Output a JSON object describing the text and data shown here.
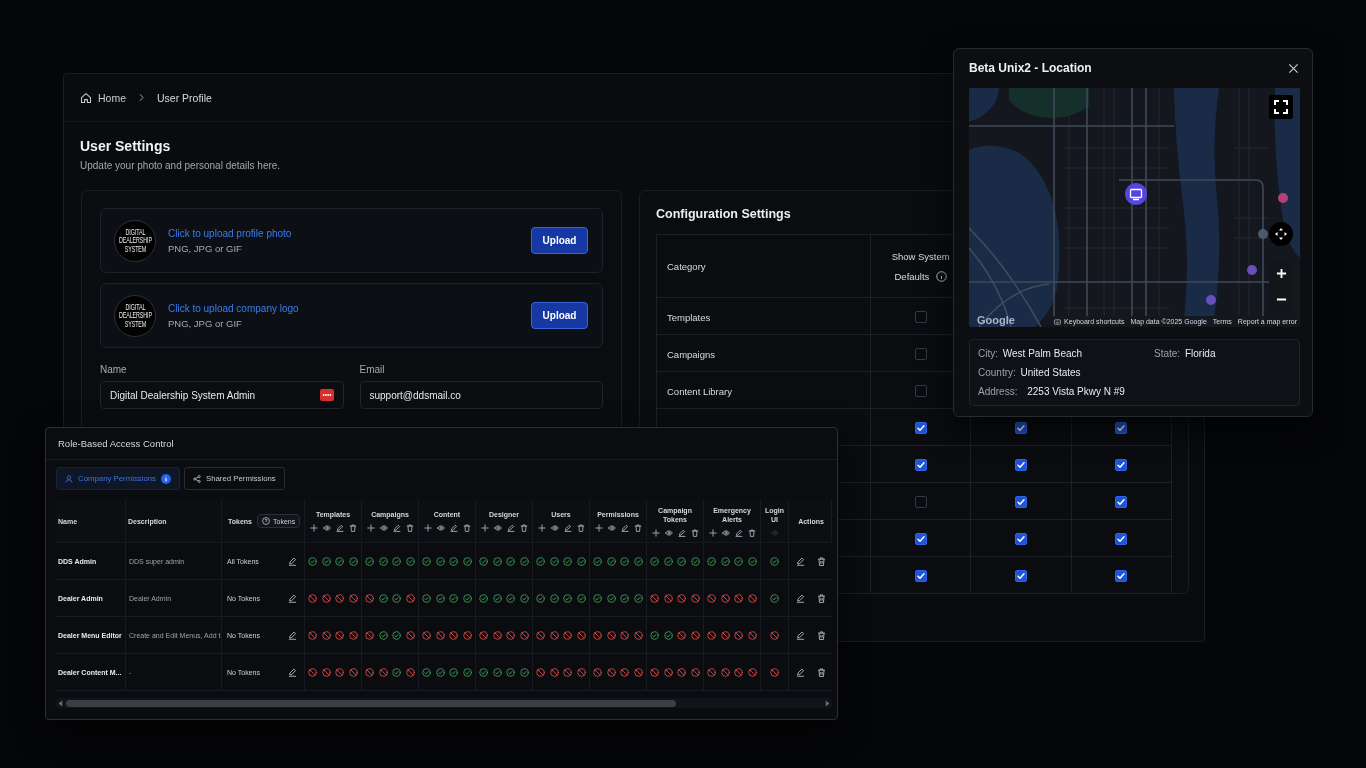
{
  "breadcrumb": [
    {
      "label": "Home",
      "kind": "home"
    },
    {
      "label": "User Profile",
      "kind": "page"
    }
  ],
  "settings": {
    "title": "User Settings",
    "subtitle": "Update your photo and personal details here.",
    "uploads": [
      {
        "logo_text": "DIGITAL DEALERSHIP SYSTEM",
        "link": "Click to upload profile photo",
        "hint": "PNG, JPG or GIF",
        "button": "Upload"
      },
      {
        "logo_text": "DIGITAL DEALERSHIP SYSTEM",
        "link": "Click to upload company logo",
        "hint": "PNG, JPG or GIF",
        "button": "Upload"
      }
    ],
    "fields": [
      {
        "label": "Name",
        "value": "Digital Dealership System Admin",
        "kind": "autofill"
      },
      {
        "label": "Email",
        "value": "support@ddsmail.co",
        "kind": "plain"
      }
    ]
  },
  "configuration": {
    "title": "Configuration Settings",
    "columns": [
      {
        "label": "Category",
        "info": false
      },
      {
        "label": "Show System Defaults",
        "info": true
      }
    ],
    "rows": [
      {
        "category": "Templates",
        "cells": [
          {
            "checked": false
          }
        ]
      },
      {
        "category": "Campaigns",
        "cells": [
          {
            "checked": false
          }
        ]
      },
      {
        "category": "Content Library",
        "cells": [
          {
            "checked": false
          }
        ]
      },
      {
        "cells": [
          {
            "checked": true
          },
          {
            "checked": true
          },
          {
            "checked": true
          }
        ]
      },
      {
        "cells": [
          {
            "checked": true
          },
          {
            "checked": true
          },
          {
            "checked": true
          }
        ]
      },
      {
        "cells": [
          {
            "checked": false
          },
          {
            "checked": true
          },
          {
            "checked": true
          }
        ]
      },
      {
        "cells": [
          {
            "checked": true
          },
          {
            "checked": true
          },
          {
            "checked": true
          }
        ]
      },
      {
        "cells": [
          {
            "checked": true
          },
          {
            "checked": true
          },
          {
            "checked": true
          }
        ]
      }
    ]
  },
  "location": {
    "title": "Beta Unix2 - Location",
    "map": {
      "logo": "Google",
      "attribution": [
        {
          "label": "Keyboard shortcuts",
          "kind": "shortcuts"
        },
        {
          "label": "Map data ©2025 Google",
          "kind": "text"
        },
        {
          "label": "Terms",
          "kind": "link"
        },
        {
          "label": "Report a map error",
          "kind": "link"
        }
      ]
    },
    "details": [
      {
        "label": "City:",
        "value": "West Palm Beach"
      },
      {
        "label": "State:",
        "value": "Florida"
      },
      {
        "label": "Country:",
        "value": "United States"
      },
      {
        "label": "Address:",
        "value": "2253 Vista Pkwy N #9"
      }
    ]
  },
  "access_control": {
    "title": "Role-Based Access Control",
    "tabs": [
      {
        "label": "Company Permissions",
        "kind": "company",
        "selected": true,
        "info": true
      },
      {
        "label": "Shared Permissions",
        "kind": "shared",
        "selected": false,
        "info": false
      }
    ],
    "columns": {
      "name": "Name",
      "description": "Description",
      "tokens": "Tokens",
      "tokens_button": "Tokens",
      "actions": "Actions"
    },
    "groups": [
      {
        "label": "Templates",
        "kind": "crud"
      },
      {
        "label": "Campaigns",
        "kind": "crud"
      },
      {
        "label": "Content",
        "kind": "crud"
      },
      {
        "label": "Designer",
        "kind": "crud"
      },
      {
        "label": "Users",
        "kind": "crud"
      },
      {
        "label": "Permissions",
        "kind": "crud"
      },
      {
        "label": "Campaign Tokens",
        "kind": "crud"
      },
      {
        "label": "Emergency Alerts",
        "kind": "crud"
      },
      {
        "label": "Login UI",
        "kind": "single"
      }
    ],
    "rows": [
      {
        "name": "DDS Admin",
        "description": "DDS super admin",
        "tokens": "All Tokens",
        "permissions": [
          [
            {
              "allowed": true
            },
            {
              "allowed": true
            },
            {
              "allowed": true
            },
            {
              "allowed": true
            }
          ],
          [
            {
              "allowed": true
            },
            {
              "allowed": true
            },
            {
              "allowed": true
            },
            {
              "allowed": true
            }
          ],
          [
            {
              "allowed": true
            },
            {
              "allowed": true
            },
            {
              "allowed": true
            },
            {
              "allowed": true
            }
          ],
          [
            {
              "allowed": true
            },
            {
              "allowed": true
            },
            {
              "allowed": true
            },
            {
              "allowed": true
            }
          ],
          [
            {
              "allowed": true
            },
            {
              "allowed": true
            },
            {
              "allowed": true
            },
            {
              "allowed": true
            }
          ],
          [
            {
              "allowed": true
            },
            {
              "allowed": true
            },
            {
              "allowed": true
            },
            {
              "allowed": true
            }
          ],
          [
            {
              "allowed": true
            },
            {
              "allowed": true
            },
            {
              "allowed": true
            },
            {
              "allowed": true
            }
          ],
          [
            {
              "allowed": true
            },
            {
              "allowed": true
            },
            {
              "allowed": true
            },
            {
              "allowed": true
            }
          ],
          [
            {
              "allowed": true
            }
          ]
        ]
      },
      {
        "name": "Dealer Admin",
        "description": "Dealer Admin",
        "tokens": "No Tokens",
        "permissions": [
          [
            {
              "allowed": false
            },
            {
              "allowed": false
            },
            {
              "allowed": false
            },
            {
              "allowed": false
            }
          ],
          [
            {
              "allowed": false
            },
            {
              "allowed": true
            },
            {
              "allowed": true
            },
            {
              "allowed": false
            }
          ],
          [
            {
              "allowed": true
            },
            {
              "allowed": true
            },
            {
              "allowed": true
            },
            {
              "allowed": true
            }
          ],
          [
            {
              "allowed": true
            },
            {
              "allowed": true
            },
            {
              "allowed": true
            },
            {
              "allowed": true
            }
          ],
          [
            {
              "allowed": true
            },
            {
              "allowed": true
            },
            {
              "allowed": true
            },
            {
              "allowed": true
            }
          ],
          [
            {
              "allowed": true
            },
            {
              "allowed": true
            },
            {
              "allowed": true
            },
            {
              "allowed": true
            }
          ],
          [
            {
              "allowed": false
            },
            {
              "allowed": false
            },
            {
              "allowed": false
            },
            {
              "allowed": false
            }
          ],
          [
            {
              "allowed": false
            },
            {
              "allowed": false
            },
            {
              "allowed": false
            },
            {
              "allowed": false
            }
          ],
          [
            {
              "allowed": true
            }
          ]
        ]
      },
      {
        "name": "Dealer Menu Editor",
        "description": "Create and Edit Menus, Add t",
        "tokens": "No Tokens",
        "permissions": [
          [
            {
              "allowed": false
            },
            {
              "allowed": false
            },
            {
              "allowed": false
            },
            {
              "allowed": false
            }
          ],
          [
            {
              "allowed": false
            },
            {
              "allowed": true
            },
            {
              "allowed": true
            },
            {
              "allowed": false
            }
          ],
          [
            {
              "allowed": false
            },
            {
              "allowed": false
            },
            {
              "allowed": false
            },
            {
              "allowed": false
            }
          ],
          [
            {
              "allowed": false
            },
            {
              "allowed": false
            },
            {
              "allowed": false
            },
            {
              "allowed": false
            }
          ],
          [
            {
              "allowed": false
            },
            {
              "allowed": false
            },
            {
              "allowed": false
            },
            {
              "allowed": false
            }
          ],
          [
            {
              "allowed": false
            },
            {
              "allowed": false
            },
            {
              "allowed": false
            },
            {
              "allowed": false
            }
          ],
          [
            {
              "allowed": true
            },
            {
              "allowed": true
            },
            {
              "allowed": false
            },
            {
              "allowed": false
            }
          ],
          [
            {
              "allowed": false
            },
            {
              "allowed": false
            },
            {
              "allowed": false
            },
            {
              "allowed": false
            }
          ],
          [
            {
              "allowed": false
            }
          ]
        ]
      },
      {
        "name": "Dealer Content M...",
        "description": "-",
        "tokens": "No Tokens",
        "permissions": [
          [
            {
              "allowed": false
            },
            {
              "allowed": false
            },
            {
              "allowed": false
            },
            {
              "allowed": false
            }
          ],
          [
            {
              "allowed": false
            },
            {
              "allowed": false
            },
            {
              "allowed": true
            },
            {
              "allowed": false
            }
          ],
          [
            {
              "allowed": true
            },
            {
              "allowed": true
            },
            {
              "allowed": true
            },
            {
              "allowed": true
            }
          ],
          [
            {
              "allowed": true
            },
            {
              "allowed": true
            },
            {
              "allowed": true
            },
            {
              "allowed": true
            }
          ],
          [
            {
              "allowed": false
            },
            {
              "allowed": false
            },
            {
              "allowed": false
            },
            {
              "allowed": false
            }
          ],
          [
            {
              "allowed": false
            },
            {
              "allowed": false
            },
            {
              "allowed": false
            },
            {
              "allowed": false
            }
          ],
          [
            {
              "allowed": false
            },
            {
              "allowed": false
            },
            {
              "allowed": false
            },
            {
              "allowed": false
            }
          ],
          [
            {
              "allowed": false
            },
            {
              "allowed": false
            },
            {
              "allowed": false
            },
            {
              "allowed": false
            }
          ],
          [
            {
              "allowed": false
            }
          ]
        ]
      }
    ]
  }
}
